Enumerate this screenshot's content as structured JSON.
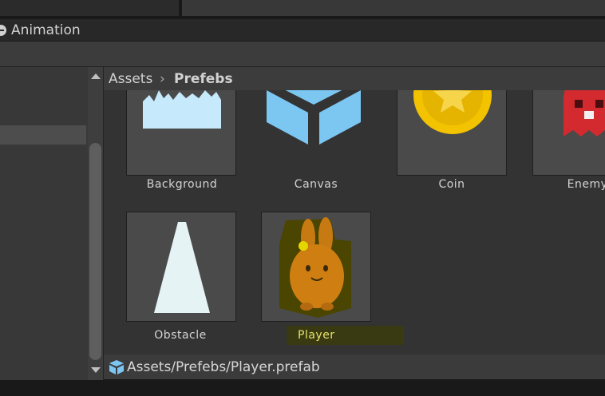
{
  "panel": {
    "title": "Animation"
  },
  "breadcrumb": {
    "root": "Assets",
    "separator": "›",
    "current": "Prefebs"
  },
  "assets": [
    {
      "name": "Background",
      "icon": "background-sprite-icon",
      "selected": false
    },
    {
      "name": "Canvas",
      "icon": "prefab-cube-icon",
      "selected": false
    },
    {
      "name": "Coin",
      "icon": "coin-icon",
      "selected": false
    },
    {
      "name": "Enemy",
      "icon": "enemy-sprite-icon",
      "selected": false
    },
    {
      "name": "Obstacle",
      "icon": "obstacle-spike-icon",
      "selected": false
    },
    {
      "name": "Player",
      "icon": "player-bunny-icon",
      "selected": true
    }
  ],
  "status": {
    "path": "Assets/Prefebs/Player.prefab",
    "icon": "prefab-cube-icon"
  },
  "colors": {
    "selected_label": "#e6e36a",
    "selected_label_bg": "#3a3a12",
    "prefab_blue": "#7cc6f2"
  }
}
